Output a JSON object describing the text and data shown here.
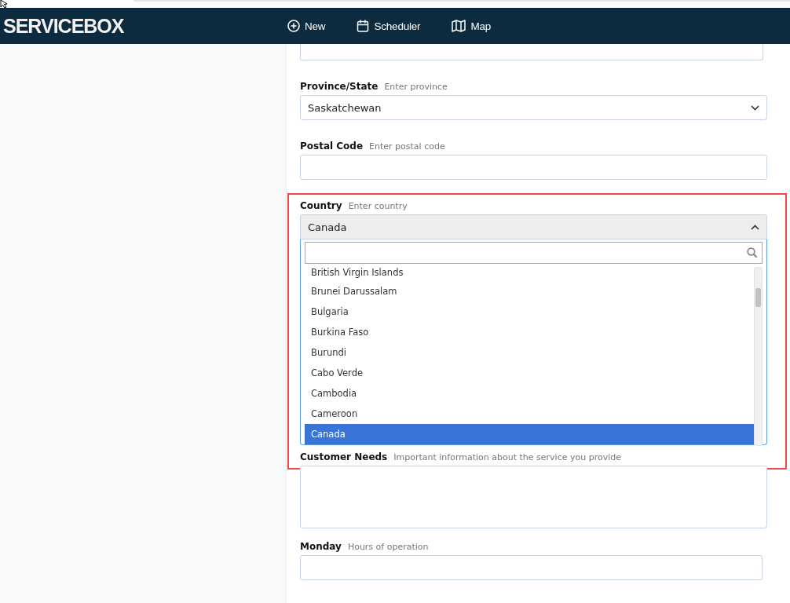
{
  "header": {
    "logo": "SERVICEBOX",
    "nav": [
      {
        "label": "New",
        "kind": "new"
      },
      {
        "label": "Scheduler",
        "kind": "scheduler"
      },
      {
        "label": "Map",
        "kind": "map"
      }
    ]
  },
  "form": {
    "fields": [
      {
        "kind": "partial"
      },
      {
        "kind": "select",
        "label": "Province/State",
        "hint": "Enter province",
        "value": "Saskatchewan"
      },
      {
        "kind": "text",
        "label": "Postal Code",
        "hint": "Enter postal code"
      },
      {
        "kind": "combo",
        "label": "Country",
        "hint": "Enter country",
        "value": "Canada",
        "expanded": true,
        "options": [
          {
            "label": "British Virgin Islands",
            "selected": false
          },
          {
            "label": "Brunei Darussalam",
            "selected": false
          },
          {
            "label": "Bulgaria",
            "selected": false
          },
          {
            "label": "Burkina Faso",
            "selected": false
          },
          {
            "label": "Burundi",
            "selected": false
          },
          {
            "label": "Cabo Verde",
            "selected": false
          },
          {
            "label": "Cambodia",
            "selected": false
          },
          {
            "label": "Cameroon",
            "selected": false
          },
          {
            "label": "Canada",
            "selected": true
          }
        ]
      },
      {
        "kind": "textarea",
        "label": "Customer Needs",
        "hint": "Important information about the service you provide"
      },
      {
        "kind": "text",
        "label": "Monday",
        "hint": "Hours of operation"
      }
    ]
  }
}
